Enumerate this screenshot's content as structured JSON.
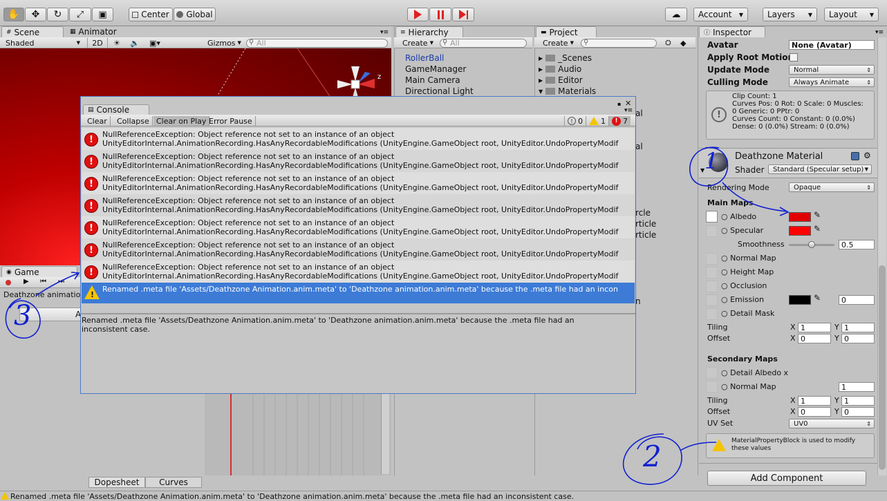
{
  "toolbar": {
    "pivot_label": "Center",
    "space_label": "Global",
    "account_label": "Account",
    "layers_label": "Layers",
    "layout_label": "Layout"
  },
  "scene": {
    "tab_scene": "Scene",
    "tab_animator": "Animator",
    "shading_mode": "Shaded",
    "mode_2d": "2D",
    "gizmos_label": "Gizmos",
    "search_placeholder": "All",
    "axis_z": "z"
  },
  "hierarchy": {
    "tab": "Hierarchy",
    "create_label": "Create",
    "search_placeholder": "All",
    "items": [
      "RollerBall",
      "GameManager",
      "Main Camera",
      "Directional Light"
    ]
  },
  "project": {
    "tab": "Project",
    "create_label": "Create",
    "folders": [
      "_Scenes",
      "Audio",
      "Editor",
      "Materials"
    ],
    "hidden_fragments": [
      "al",
      "al",
      "rcle",
      "rticle",
      "rticle",
      "n"
    ]
  },
  "game": {
    "tab": "Game",
    "clip_name": "Deathzone animation",
    "btn_fragment": "A"
  },
  "animation": {
    "tab_dopesheet": "Dopesheet",
    "tab_curves": "Curves"
  },
  "console": {
    "tab": "Console",
    "buttons": [
      "Clear",
      "Collapse",
      "Clear on Play",
      "Error Pause"
    ],
    "info_count": "0",
    "warn_count": "1",
    "error_count": "7",
    "error_line1": "NullReferenceException: Object reference not set to an instance of an object",
    "error_line2": "UnityEditorInternal.AnimationRecording.HasAnyRecordableModifications (UnityEngine.GameObject root, UnityEditor.UndoPropertyModif",
    "warning_line": "Renamed .meta file 'Assets/Deathzone Animation.anim.meta' to 'Deathzone animation.anim.meta' because the .meta file had an incon",
    "detail_text": "Renamed .meta file 'Assets/Deathzone Animation.anim.meta' to 'Deathzone animation.anim.meta' because the .meta file had an inconsistent case."
  },
  "inspector": {
    "tab": "Inspector",
    "avatar_label": "Avatar",
    "avatar_value": "None (Avatar)",
    "apply_root_motion_label": "Apply Root Motion",
    "update_mode_label": "Update Mode",
    "update_mode_value": "Normal",
    "culling_mode_label": "Culling Mode",
    "culling_mode_value": "Always Animate",
    "info_lines": [
      "Clip Count: 1",
      "Curves Pos: 0 Rot: 0 Scale: 0 Muscles:",
      "0 Generic: 0 PPtr: 0",
      "Curves Count: 0 Constant: 0 (0.0%)",
      "Dense: 0 (0.0%) Stream: 0 (0.0%)"
    ],
    "material_name": "Deathzone Material",
    "shader_label": "Shader",
    "shader_value": "Standard (Specular setup)",
    "rendering_mode_label": "Rendering Mode",
    "rendering_mode_value": "Opaque",
    "main_maps_label": "Main Maps",
    "albedo_label": "Albedo",
    "specular_label": "Specular",
    "smoothness_label": "Smoothness",
    "smoothness_value": "0.5",
    "smoothness_fraction": 0.5,
    "normal_map_label": "Normal Map",
    "height_map_label": "Height Map",
    "occlusion_label": "Occlusion",
    "emission_label": "Emission",
    "emission_value": "0",
    "detail_mask_label": "Detail Mask",
    "tiling_label": "Tiling",
    "offset_label": "Offset",
    "x_label": "X",
    "y_label": "Y",
    "tiling_x": "1",
    "tiling_y": "1",
    "offset_x": "0",
    "offset_y": "0",
    "secondary_maps_label": "Secondary Maps",
    "detail_albedo_label": "Detail Albedo x",
    "normal_map2_label": "Normal Map",
    "normal_map2_value": "1",
    "tiling2_x": "1",
    "tiling2_y": "1",
    "offset2_x": "0",
    "offset2_y": "0",
    "uv_set_label": "UV Set",
    "uv_set_value": "UV0",
    "mpb_warning": "MaterialPropertyBlock is used to modify these values",
    "add_component_label": "Add Component"
  },
  "status_bar": {
    "text": "Renamed .meta file 'Assets/Deathzone Animation.anim.meta' to 'Deathzone animation.anim.meta' because the .meta file had an inconsistent case."
  },
  "annotations": [
    "1",
    "2",
    "3"
  ],
  "colors": {
    "albedo": "#e00000",
    "specular": "#ff0000",
    "emission": "#000000",
    "selection": "#3d7bd6",
    "error": "#e01010",
    "warning": "#f4c400",
    "pen": "#1020d0",
    "scene_red": "#8a0000"
  }
}
